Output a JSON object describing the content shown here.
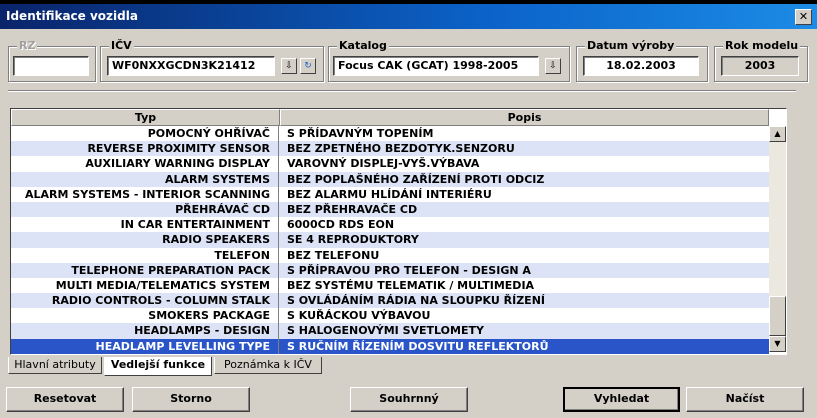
{
  "window": {
    "title": "Identifikace vozidla",
    "close_glyph": "✕"
  },
  "fields": {
    "rz": {
      "label": "RZ",
      "value": ""
    },
    "icv": {
      "label": "IČV",
      "value": "WF0NXXGCDN3K21412"
    },
    "katalog": {
      "label": "Katalog",
      "value": "Focus CAK (GCAT) 1998-2005"
    },
    "datum": {
      "label": "Datum výroby",
      "value": "18.02.2003"
    },
    "rok": {
      "label": "Rok modelu",
      "value": "2003"
    }
  },
  "table": {
    "columns": [
      "Typ",
      "Popis"
    ],
    "rows": [
      {
        "typ": "POMOCNÝ OHŘÍVAČ",
        "popis": "S PŘÍDAVNÝM TOPENÍM"
      },
      {
        "typ": "REVERSE PROXIMITY SENSOR",
        "popis": "BEZ ZPETNÉHO BEZDOTYK.SENZORU"
      },
      {
        "typ": "AUXILIARY WARNING DISPLAY",
        "popis": "VAROVNÝ DISPLEJ-VYŠ.VÝBAVA"
      },
      {
        "typ": "ALARM SYSTEMS",
        "popis": "BEZ POPLAŠNÉHO ZAŘÍZENÍ PROTI ODCIZ"
      },
      {
        "typ": "ALARM SYSTEMS - INTERIOR SCANNING",
        "popis": "BEZ ALARMU HLÍDÁNÍ INTERIÉRU"
      },
      {
        "typ": "PŘEHRÁVAČ CD",
        "popis": "BEZ PŘEHRAVAČE CD"
      },
      {
        "typ": "IN CAR ENTERTAINMENT",
        "popis": "6000CD RDS EON"
      },
      {
        "typ": "RADIO SPEAKERS",
        "popis": "SE 4 REPRODUKTORY"
      },
      {
        "typ": "TELEFON",
        "popis": "BEZ TELEFONU"
      },
      {
        "typ": "TELEPHONE PREPARATION PACK",
        "popis": "S PŘÍPRAVOU PRO TELEFON - DESIGN A"
      },
      {
        "typ": "MULTI MEDIA/TELEMATICS SYSTEM",
        "popis": "BEZ SYSTÉMU TELEMATIK / MULTIMEDIA"
      },
      {
        "typ": "RADIO CONTROLS - COLUMN STALK",
        "popis": "S OVLÁDÁNÍM RÁDIA NA SLOUPKU ŘÍZENÍ"
      },
      {
        "typ": "SMOKERS PACKAGE",
        "popis": "S KUŘÁCKOU VÝBAVOU"
      },
      {
        "typ": "HEADLAMPS - DESIGN",
        "popis": "S HALOGENOVÝMI SVETLOMETY"
      },
      {
        "typ": "HEADLAMP LEVELLING TYPE",
        "popis": "S RUČNÍM ŘÍZENÍM DOSVITU REFLEKTORŮ"
      }
    ],
    "selected_row": 14
  },
  "tabs": [
    "Hlavní atributy",
    "Vedlejší funkce",
    "Poznámka k IČV"
  ],
  "active_tab": 1,
  "buttons": {
    "reset": "Resetovat",
    "storno": "Storno",
    "souhrnny": "Souhrnný",
    "vyhledat": "Vyhledat",
    "nacist": "Načíst"
  },
  "icons": {
    "dropdown": "dropdown-arrow-icon",
    "refresh": "refresh-icon",
    "scroll_up": "scroll-up-icon",
    "scroll_down": "scroll-down-icon"
  },
  "colors": {
    "title_start": "#0a246a",
    "title_end": "#1c8ce6",
    "row_alt": "#dde3f6",
    "row_selected": "#2a55c8"
  }
}
